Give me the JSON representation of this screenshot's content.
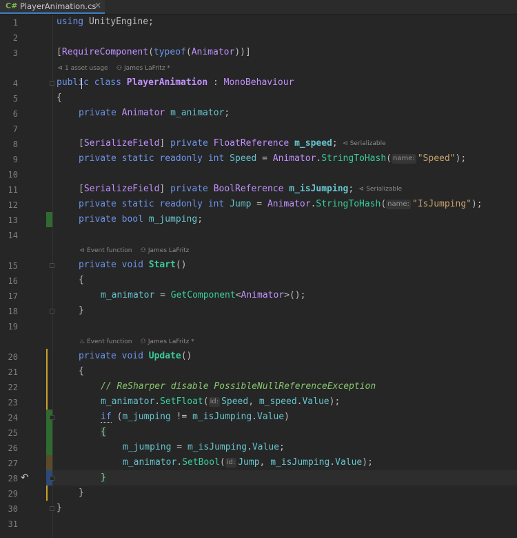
{
  "tab": {
    "lang_badge": "C#",
    "filename": "PlayerAnimation.cs",
    "close_glyph": "✕"
  },
  "line_numbers": [
    "1",
    "2",
    "3",
    "4",
    "5",
    "6",
    "7",
    "8",
    "9",
    "10",
    "11",
    "12",
    "13",
    "14",
    "15",
    "16",
    "17",
    "18",
    "19",
    "20",
    "21",
    "22",
    "23",
    "24",
    "25",
    "26",
    "27",
    "28",
    "29",
    "30",
    "31"
  ],
  "code": {
    "l1": {
      "kw": "using",
      "ns": " UnityEngine;"
    },
    "l3": {
      "open": "[",
      "attr": "RequireComponent",
      "p1": "(",
      "kw": "typeof",
      "p2": "(",
      "ty": "Animator",
      "close": "))]"
    },
    "hint_class": {
      "usages": "1 asset usage",
      "author": "James LaFritz *"
    },
    "l4": {
      "kw1": "public",
      "kw2": " class ",
      "name": "PlayerAnimation",
      "colon": " : ",
      "base": "MonoBehaviour"
    },
    "l5": "{",
    "l6": {
      "kw": "private",
      "ty": " Animator ",
      "field": "m_animator",
      "semi": ";"
    },
    "l8": {
      "open": "[",
      "attr": "SerializeField",
      "close": "] ",
      "kw": "private ",
      "ty": "FloatReference ",
      "field": "m_speed",
      "semi": ";",
      "hint": "Serializable"
    },
    "l9": {
      "kw": "private static readonly int ",
      "field": "Speed",
      "eq": " = ",
      "ty": "Animator",
      "dot": ".",
      "fn": "StringToHash",
      "p1": "(",
      "hint": "name:",
      "str": "\"Speed\"",
      "end": ");"
    },
    "l11": {
      "open": "[",
      "attr": "SerializeField",
      "close": "] ",
      "kw": "private ",
      "ty": "BoolReference ",
      "field": "m_isJumping",
      "semi": ";",
      "hint": "Serializable"
    },
    "l12": {
      "kw": "private static readonly int ",
      "field": "Jump",
      "eq": " = ",
      "ty": "Animator",
      "dot": ".",
      "fn": "StringToHash",
      "p1": "(",
      "hint": "name:",
      "str": "\"IsJumping\"",
      "end": ");"
    },
    "l13": {
      "kw": "private bool ",
      "field": "m_jumping",
      "semi": ";"
    },
    "hint_start": {
      "event": "Event function",
      "author": "James LaFritz"
    },
    "l15": {
      "kw": "private void ",
      "fn": "Start",
      "rest": "()"
    },
    "l16": "{",
    "l17": {
      "field": "m_animator",
      "eq": " = ",
      "fn": "GetComponent",
      "lt": "<",
      "ty": "Animator",
      "rest": ">();"
    },
    "l18": "}",
    "hint_update": {
      "event": "Event function",
      "author": "James LaFritz *"
    },
    "l20": {
      "kw": "private void ",
      "fn": "Update",
      "rest": "()"
    },
    "l21": "{",
    "l22": "// ReSharper disable PossibleNullReferenceException",
    "l23": {
      "field": "m_animator",
      "dot": ".",
      "fn": "SetFloat",
      "p1": "(",
      "hint": "id:",
      "arg1": "Speed",
      "comma": ", ",
      "arg2": "m_speed",
      "dot2": ".",
      "arg3": "Value",
      "end": ");"
    },
    "l24": {
      "kw": "if",
      "p1": " (",
      "a": "m_jumping",
      "op": " != ",
      "b": "m_isJumping",
      "dot": ".",
      "c": "Value",
      "end": ")"
    },
    "l25": "{",
    "l26": {
      "field": "m_jumping",
      "eq": " = ",
      "b": "m_isJumping",
      "dot": ".",
      "c": "Value",
      "semi": ";"
    },
    "l27": {
      "field": "m_animator",
      "dot": ".",
      "fn": "SetBool",
      "p1": "(",
      "hint": "id:",
      "arg1": "Jump",
      "comma": ", ",
      "arg2": "m_isJumping",
      "dot2": ".",
      "arg3": "Value",
      "end": ");"
    },
    "l28": "}",
    "l29": "}",
    "l30": "}"
  },
  "colors": {
    "background": "#262626",
    "keyword": "#6c95eb",
    "type": "#c191ff",
    "method": "#39cc9b",
    "field": "#66c3cc",
    "string": "#c9a26d",
    "comment": "#85c46c",
    "added": "#2f6b2f",
    "modified": "#6b6a2f",
    "modified_yellow": "#c9a12b"
  },
  "icons": {
    "revert": "revert-icon",
    "usage": "usage-icon",
    "author": "person-icon",
    "serializable": "serializable-icon",
    "event": "event-function-icon"
  }
}
